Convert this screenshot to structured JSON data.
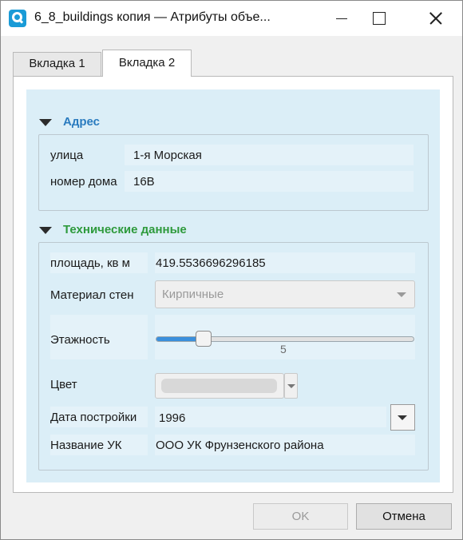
{
  "window": {
    "title": "6_8_buildings копия — Атрибуты объе...",
    "brand_color": "#1a9bd7"
  },
  "tabs": [
    {
      "label": "Вкладка 1",
      "active": false
    },
    {
      "label": "Вкладка 2",
      "active": true
    }
  ],
  "groups": {
    "address": {
      "title": "Адрес",
      "title_color": "#2a7bbf",
      "fields": {
        "street": {
          "label": "улица",
          "value": "1-я Морская"
        },
        "house": {
          "label": "номер дома",
          "value": "16В"
        }
      }
    },
    "technical": {
      "title": "Технические данные",
      "title_color": "#2e9a3c",
      "fields": {
        "area": {
          "label": "площадь, кв м",
          "value": "419.5536696296185"
        },
        "material": {
          "label": "Материал стен",
          "value": "Кирпичные"
        },
        "floors": {
          "label": "Этажность",
          "value": "5",
          "fill_fraction": 0.19
        },
        "color": {
          "label": "Цвет"
        },
        "built": {
          "label": "Дата постройки",
          "value": "1996"
        },
        "company": {
          "label": "Название УК",
          "value": "ООО УК Фрунзенского района"
        }
      }
    }
  },
  "buttons": {
    "ok": "OK",
    "cancel": "Отмена"
  }
}
